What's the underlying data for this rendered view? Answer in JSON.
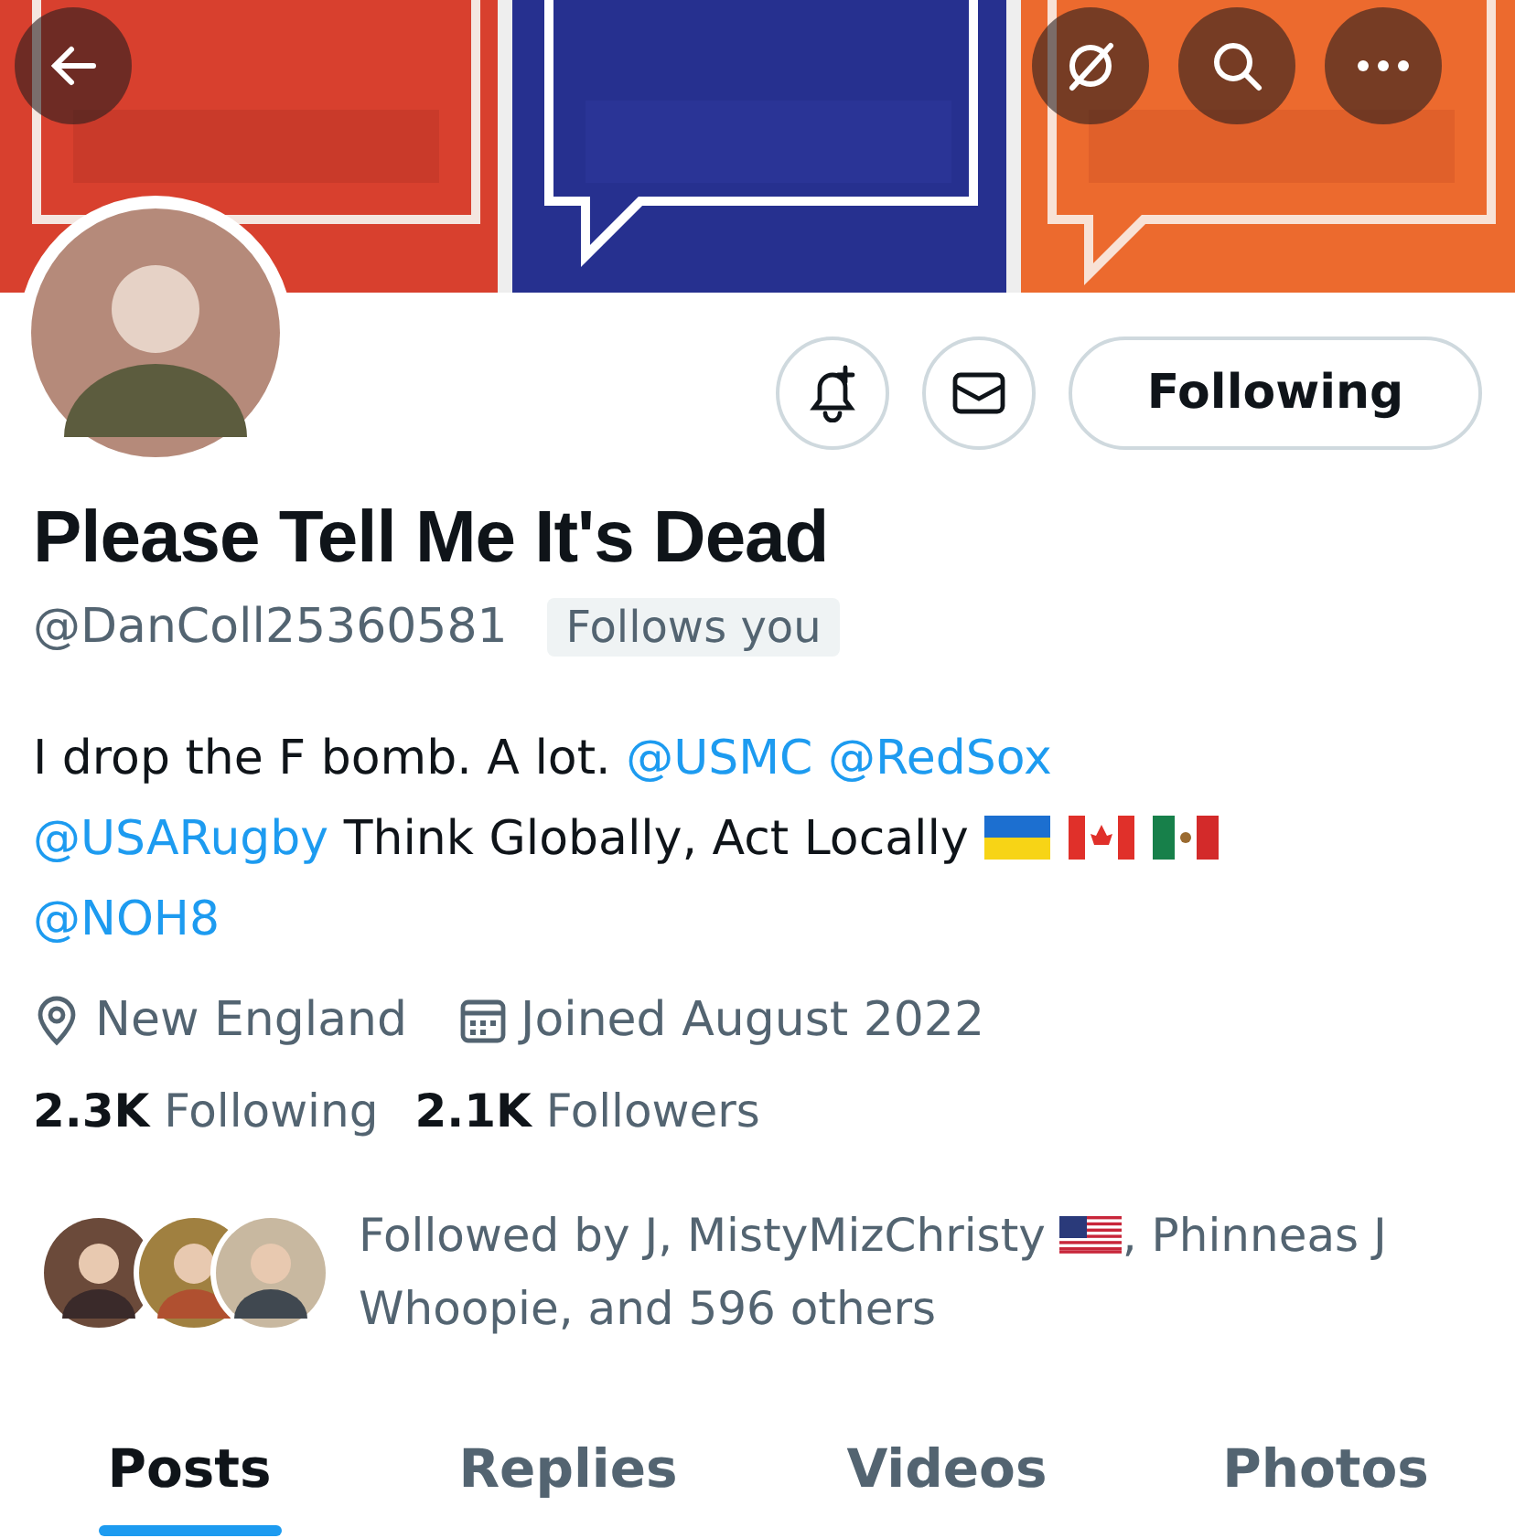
{
  "header_actions": [
    {
      "kind": "back"
    },
    {
      "kind": "hide"
    },
    {
      "kind": "search"
    },
    {
      "kind": "more"
    }
  ],
  "profile_actions": [
    {
      "kind": "notify"
    },
    {
      "kind": "message"
    },
    {
      "kind": "follow",
      "label": "Following"
    }
  ],
  "profile": {
    "name": "Please Tell Me It's Dead",
    "handle": "@DanColl25360581",
    "follows_you": "Follows you"
  },
  "bio": [
    {
      "kind": "text",
      "text": "I drop the F bomb. A lot."
    },
    {
      "kind": "mention",
      "text": "@USMC"
    },
    {
      "kind": "mention",
      "text": "@RedSox"
    },
    {
      "kind": "mention",
      "text": "@USARugby"
    },
    {
      "kind": "text",
      "text": "Think Globally, Act Locally"
    },
    {
      "kind": "flags"
    },
    {
      "kind": "mention",
      "text": "@NOH8"
    }
  ],
  "meta": [
    {
      "kind": "location",
      "text": "New England"
    },
    {
      "kind": "joined",
      "text": "Joined August 2022"
    }
  ],
  "stats": [
    {
      "count": "2.3K",
      "label": "Following"
    },
    {
      "count": "2.1K",
      "label": "Followers"
    }
  ],
  "followed_by": {
    "line_start": "Followed by J, MistyMizChristy",
    "line_end": ", Phinneas J Whoopie, and 596 others"
  },
  "tabs": [
    {
      "label": "Posts",
      "selected": true
    },
    {
      "label": "Replies",
      "selected": false
    },
    {
      "label": "Videos",
      "selected": false
    },
    {
      "label": "Photos",
      "selected": false
    }
  ]
}
